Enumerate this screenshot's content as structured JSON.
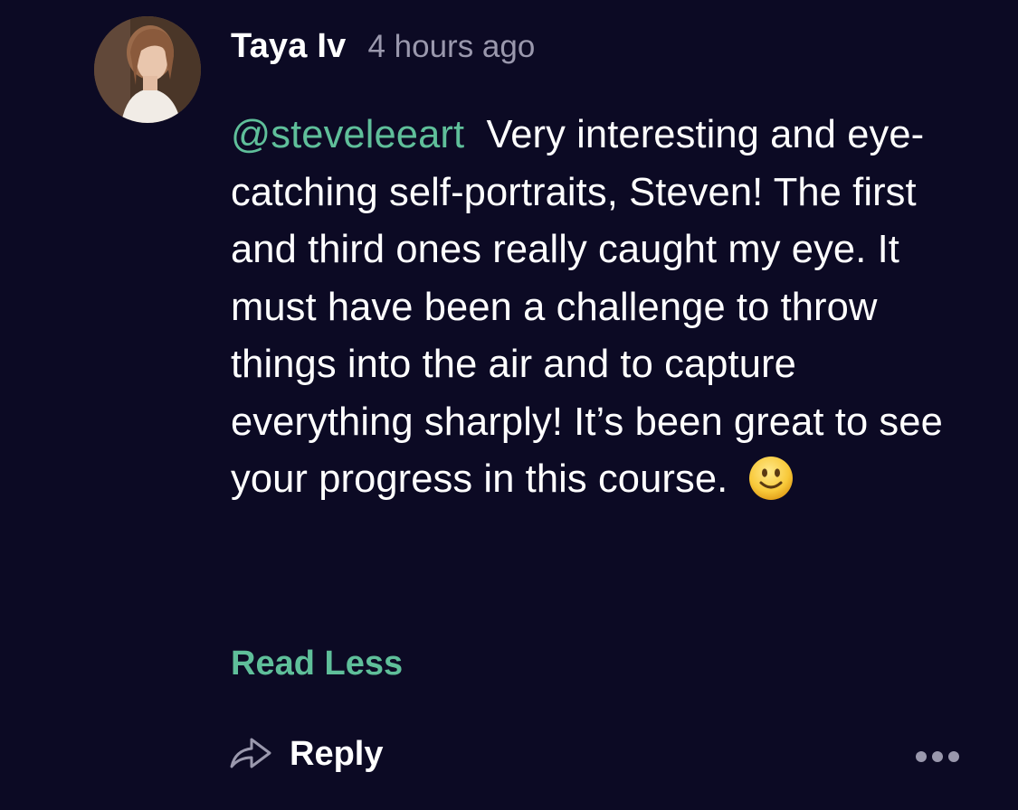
{
  "comment": {
    "author": "Taya Iv",
    "timestamp": "4 hours ago",
    "mention": "@steveleeart",
    "body": "Very interesting and eye-catching self-portraits, Steven! The first and third ones really caught my eye. It must have been a challenge to throw things into the air and to capture everything sharply! It’s been great to see your progress in this course.",
    "emoji": "slightly-smiling-face-icon",
    "toggle_label": "Read Less"
  },
  "actions": {
    "reply_label": "Reply",
    "reply_icon": "reply-arrow-icon",
    "more_icon": "more-options-icon"
  },
  "colors": {
    "background": "#0c0a24",
    "accent": "#5fbf9a",
    "muted": "#9a98ad",
    "text": "#ffffff"
  }
}
